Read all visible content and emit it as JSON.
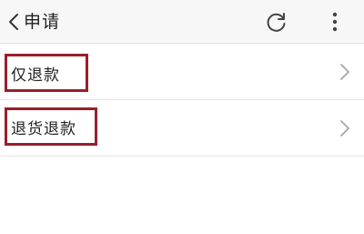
{
  "header": {
    "title": "申请",
    "back_icon": "back-arrow-icon",
    "refresh_icon": "refresh-icon",
    "more_icon": "more-vertical-icon"
  },
  "options": [
    {
      "label": "仅退款",
      "icon": "chevron-right-icon"
    },
    {
      "label": "退货退款",
      "icon": "chevron-right-icon"
    }
  ],
  "colors": {
    "header_bg": "#f7f7f7",
    "highlight_border": "#9a1e2a",
    "chevron": "#a0a0a0",
    "text": "#222222"
  }
}
